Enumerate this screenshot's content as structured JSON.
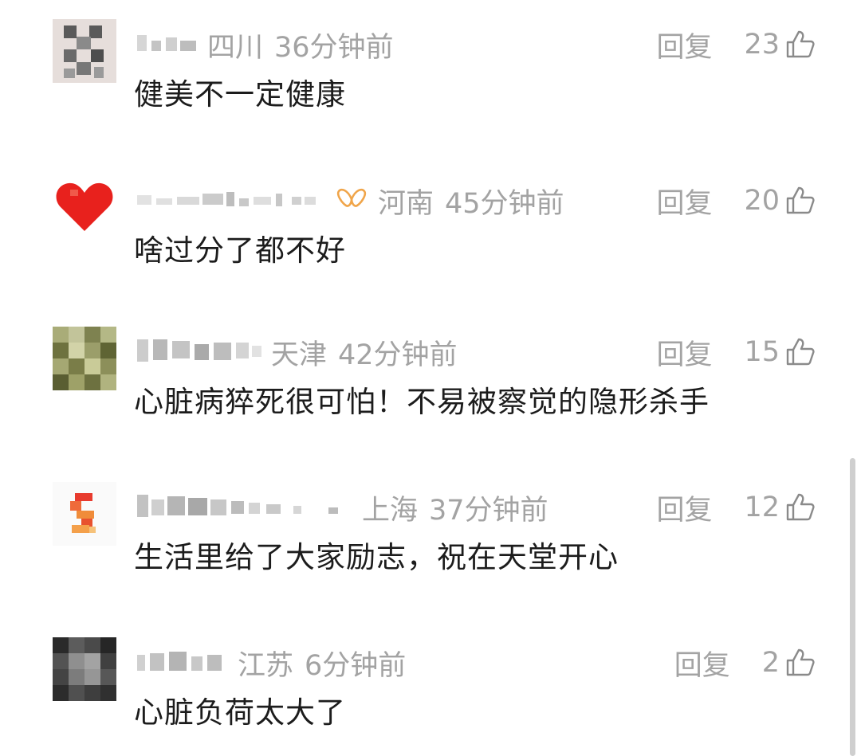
{
  "comments": [
    {
      "location": "四川",
      "time": "36分钟前",
      "reply_label": "回复",
      "likes": "23",
      "text": "健美不一定健康",
      "avatar_icon": "pixelated-avatar-icon"
    },
    {
      "location": "河南",
      "time": "45分钟前",
      "reply_label": "回复",
      "likes": "20",
      "text": "啥过分了都不好",
      "avatar_icon": "red-heart-avatar-icon",
      "badge_icon": "bow-badge-icon"
    },
    {
      "location": "天津",
      "time": "42分钟前",
      "reply_label": "回复",
      "likes": "15",
      "text": "心脏病猝死很可怕！不易被察觉的隐形杀手",
      "avatar_icon": "pixelated-avatar-icon"
    },
    {
      "location": "上海",
      "time": "37分钟前",
      "reply_label": "回复",
      "likes": "12",
      "text": "生活里给了大家励志，祝在天堂开心",
      "avatar_icon": "pixelated-avatar-icon"
    },
    {
      "location": "江苏",
      "time": "6分钟前",
      "reply_label": "回复",
      "likes": "2",
      "text": "心脏负荷太大了",
      "avatar_icon": "pixelated-avatar-icon"
    }
  ],
  "colors": {
    "meta_text": "#a3a3a3",
    "body_text": "#1c1c1c",
    "badge_orange": "#f0a54a"
  }
}
